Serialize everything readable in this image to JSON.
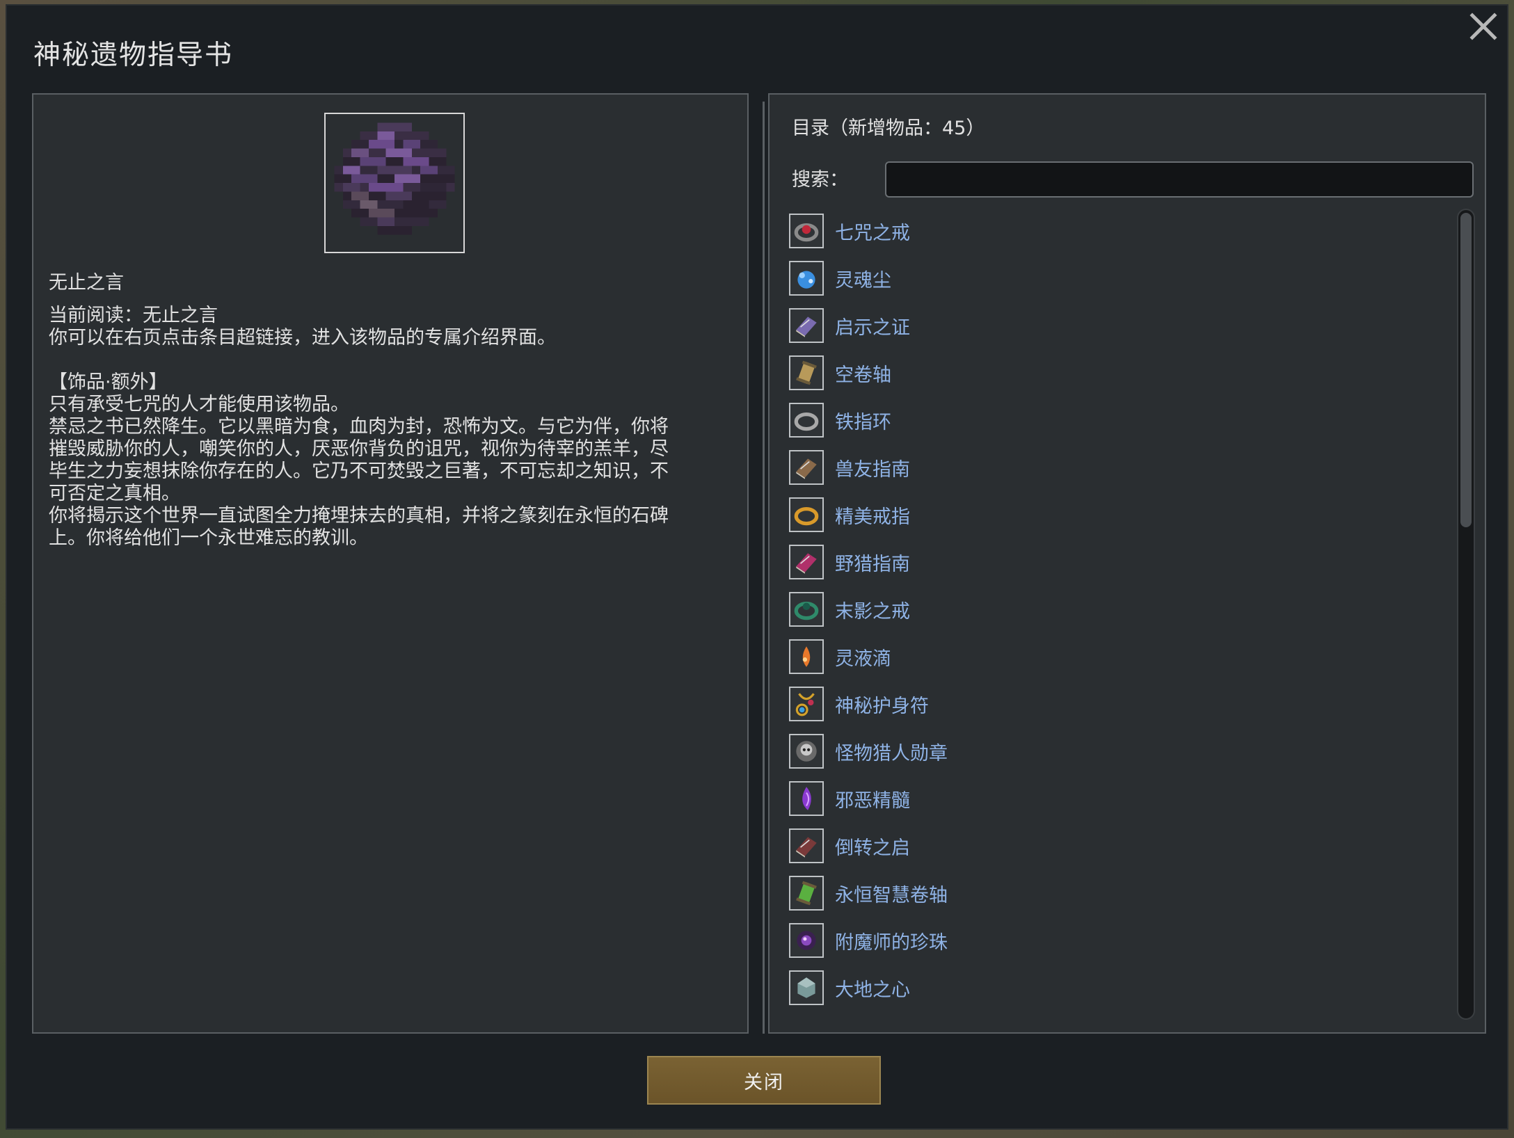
{
  "window": {
    "title": "神秘遗物指导书"
  },
  "detail": {
    "item_name": "无止之言",
    "lines": [
      "当前阅读：无止之言",
      "你可以在右页点击条目超链接，进入该物品的专属介绍界面。",
      "",
      "【饰品·额外】",
      "只有承受七咒的人才能使用该物品。",
      "禁忌之书已然降生。它以黑暗为食，血肉为封，恐怖为文。与它为伴，你将",
      "摧毁威胁你的人，嘲笑你的人，厌恶你背负的诅咒，视你为待宰的羔羊，尽",
      "毕生之力妄想抹除你存在的人。它乃不可焚毁之巨著，不可忘却之知识，不",
      "可否定之真相。",
      "你将揭示这个世界一直试图全力掩埋抹去的真相，并将之篆刻在永恒的石碑",
      "上。你将给他们一个永世难忘的教训。"
    ]
  },
  "catalog": {
    "title": "目录（新增物品：45）",
    "search_label": "搜索：",
    "search_value": "",
    "items": [
      {
        "label": "七咒之戒",
        "icon": "cursed-ring-icon",
        "color": "#c0283a"
      },
      {
        "label": "灵魂尘",
        "icon": "soul-dust-icon",
        "color": "#3a8fe0"
      },
      {
        "label": "启示之证",
        "icon": "revelation-book-icon",
        "color": "#7a6bb0"
      },
      {
        "label": "空卷轴",
        "icon": "empty-scroll-icon",
        "color": "#b89a5a"
      },
      {
        "label": "铁指环",
        "icon": "iron-ring-icon",
        "color": "#a8a8a8"
      },
      {
        "label": "兽友指南",
        "icon": "beast-guide-book-icon",
        "color": "#8a6a4a"
      },
      {
        "label": "精美戒指",
        "icon": "gold-ring-icon",
        "color": "#d99a2a"
      },
      {
        "label": "野猎指南",
        "icon": "hunt-guide-book-icon",
        "color": "#b0306a"
      },
      {
        "label": "末影之戒",
        "icon": "ender-ring-icon",
        "color": "#2f8a6a"
      },
      {
        "label": "灵液滴",
        "icon": "spirit-drop-icon",
        "color": "#e8782a"
      },
      {
        "label": "神秘护身符",
        "icon": "amulet-icon",
        "color": "#d4a22a"
      },
      {
        "label": "怪物猎人勋章",
        "icon": "skull-medal-icon",
        "color": "#c8c8c8"
      },
      {
        "label": "邪恶精髓",
        "icon": "evil-essence-icon",
        "color": "#8a3ad0"
      },
      {
        "label": "倒转之启",
        "icon": "inverted-book-icon",
        "color": "#7a3a3a"
      },
      {
        "label": "永恒智慧卷轴",
        "icon": "wisdom-scroll-icon",
        "color": "#5ab040"
      },
      {
        "label": "附魔师的珍珠",
        "icon": "enchanter-pearl-icon",
        "color": "#8a4ac0"
      },
      {
        "label": "大地之心",
        "icon": "earth-heart-icon",
        "color": "#7a9a9a"
      },
      {
        "label": "",
        "icon": "partial-item-icon",
        "color": "#888888"
      }
    ]
  },
  "buttons": {
    "close_label": "关闭"
  }
}
